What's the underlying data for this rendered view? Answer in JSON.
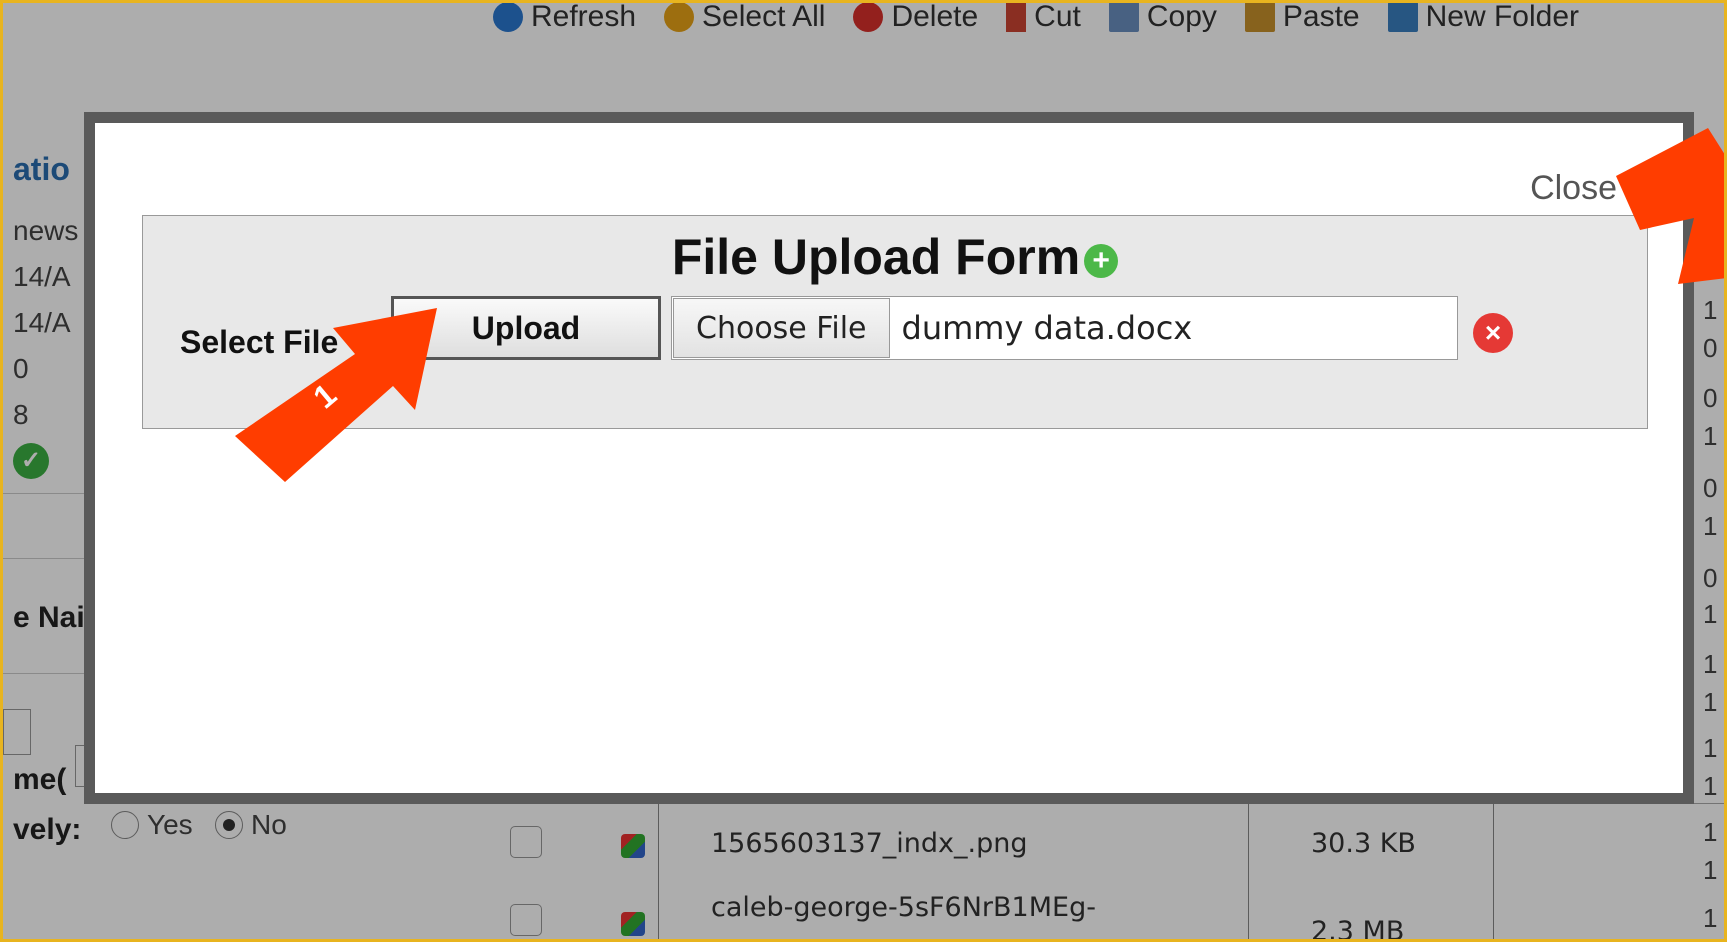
{
  "toolbar": {
    "items": [
      {
        "label": "Refresh",
        "icon": "refresh-icon",
        "color": "#2a78d0"
      },
      {
        "label": "Select All",
        "icon": "select-all-icon",
        "color": "#e8a317"
      },
      {
        "label": "Delete",
        "icon": "delete-icon",
        "color": "#d9302c"
      },
      {
        "label": "Cut",
        "icon": "cut-icon",
        "color": "#c43"
      },
      {
        "label": "Copy",
        "icon": "copy-icon",
        "color": "#6a8fc0"
      },
      {
        "label": "Paste",
        "icon": "paste-icon",
        "color": "#c8912c"
      },
      {
        "label": "New Folder",
        "icon": "new-folder-icon",
        "color": "#3a7fc0"
      }
    ]
  },
  "left_panel": {
    "title_fragment": "atio",
    "lines": [
      "news",
      "14/A",
      "14/A",
      "0",
      "8"
    ],
    "name_fragment": "e Nai",
    "time_fragment": "me(",
    "recursive_fragment": "vely:",
    "radio_yes": "Yes",
    "radio_no": "No"
  },
  "file_table": {
    "rows": [
      {
        "name": "1565603137_indx_.png",
        "size": "30.3 KB"
      },
      {
        "name": "caleb-george-5sF6NrB1MEg-",
        "size": "2.3 MB"
      }
    ]
  },
  "right_column": [
    "1",
    "0",
    "0",
    "1",
    "0",
    "1",
    "0",
    "1",
    "1",
    "1",
    "1",
    "1",
    "1",
    "1",
    "1"
  ],
  "modal": {
    "close_label": "Close",
    "form_title": "File Upload Form",
    "select_file_label": "Select File",
    "upload_label": "Upload",
    "choose_file_label": "Choose File",
    "file_name": "dummy data.docx",
    "step_number": "1"
  },
  "colors": {
    "accent_frame": "#e8b41f",
    "arrow": "#ff3d00",
    "title_link": "#2a6db0",
    "plus_icon": "#4cb848",
    "remove_icon": "#e53935"
  }
}
